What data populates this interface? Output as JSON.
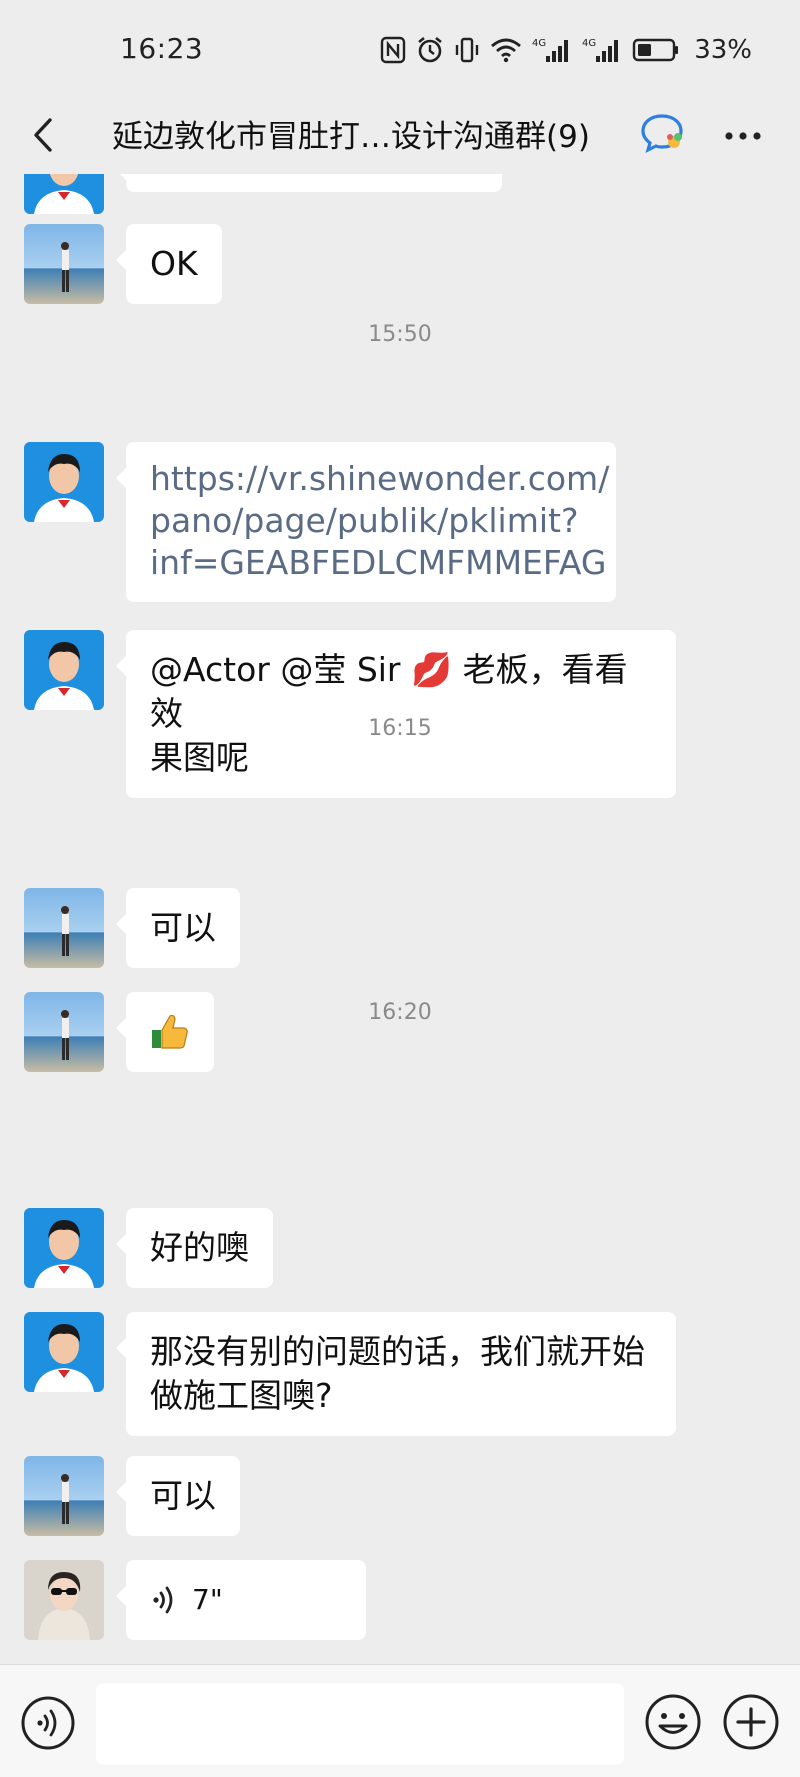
{
  "status_bar": {
    "time": "16:23",
    "battery_percent": "33%",
    "network_labels": [
      "4G",
      "4G"
    ],
    "icons": [
      "nfc-icon",
      "alarm-icon",
      "vibrate-icon",
      "wifi-icon",
      "signal-icon",
      "signal-icon",
      "battery-icon"
    ]
  },
  "header": {
    "title": "延边敦化市冒肚打…设计沟通群(9)",
    "back_icon": "back-chevron-icon",
    "more_icon": "more-dots-icon"
  },
  "messages": [
    {
      "type": "text",
      "avatar": "beach-avatar",
      "text": "OK"
    },
    {
      "type": "timestamp",
      "text": "15:50"
    },
    {
      "type": "link",
      "avatar": "boy-avatar",
      "lines": [
        "https://vr.shinewonder.com/",
        "pano/page/publik/pklimit?",
        "inf=GEABFEDLCMFMMEFAG"
      ]
    },
    {
      "type": "text",
      "avatar": "boy-avatar",
      "lines": [
        "@Actor @莹 Sir 💋 老板，看看效",
        "果图呢"
      ]
    },
    {
      "type": "timestamp",
      "text": "16:15"
    },
    {
      "type": "text",
      "avatar": "beach-avatar",
      "text": "可以"
    },
    {
      "type": "emoji",
      "avatar": "beach-avatar",
      "text": "👍"
    },
    {
      "type": "timestamp",
      "text": "16:20"
    },
    {
      "type": "text",
      "avatar": "boy-avatar",
      "text": "好的噢"
    },
    {
      "type": "text",
      "avatar": "boy-avatar",
      "lines": [
        "那没有别的问题的话，我们就开始",
        "做施工图噢?"
      ]
    },
    {
      "type": "text",
      "avatar": "beach-avatar",
      "text": "可以"
    },
    {
      "type": "voice",
      "avatar": "woman-avatar",
      "duration": "7\""
    }
  ],
  "input_bar": {
    "placeholder": "",
    "icons": [
      "voice-toggle-icon",
      "emoji-icon",
      "plus-icon"
    ]
  },
  "colors": {
    "background": "#ededed",
    "bubble": "#ffffff",
    "link_text": "#5a6b86",
    "timestamp_text": "#8a8a8a",
    "avatar_blue": "#1f8fe0"
  }
}
